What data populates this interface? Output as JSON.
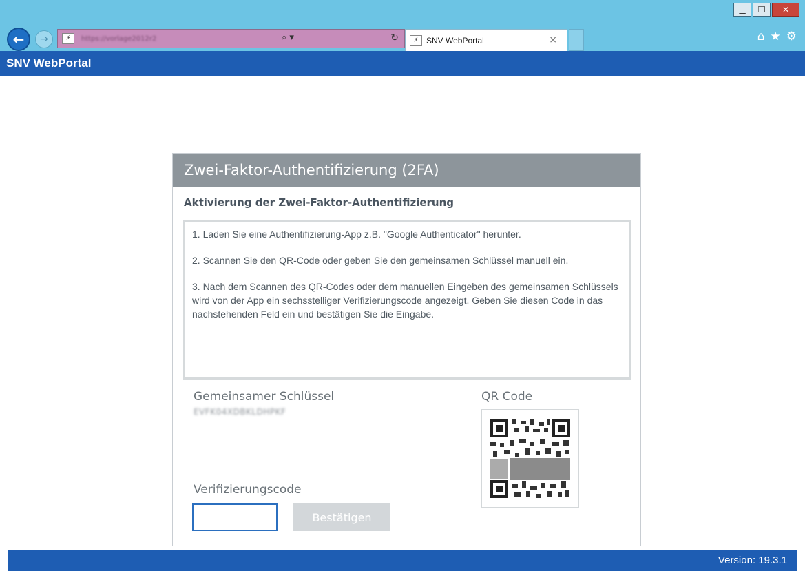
{
  "browser": {
    "window_controls": {
      "minimize": "▁",
      "restore": "❐",
      "close": "✕"
    },
    "address_text": "https://vorlage2012r2",
    "address_search_icon": "⌕ ▾",
    "address_refresh_icon": "↻",
    "tab_title": "SNV WebPortal",
    "tab_close": "×",
    "toolbar_icons": [
      "home-icon",
      "star-icon",
      "gear-icon"
    ]
  },
  "app": {
    "title": "SNV WebPortal"
  },
  "card": {
    "title": "Zwei-Faktor-Authentifizierung (2FA)",
    "subtitle": "Aktivierung der Zwei-Faktor-Authentifizierung",
    "steps": [
      "1. Laden Sie eine Authentifizierung-App z.B. \"Google Authenticator\" herunter.",
      "2. Scannen Sie den QR-Code oder geben Sie den gemeinsamen Schlüssel manuell ein.",
      "3. Nach dem Scannen des QR-Codes oder dem manuellen Eingeben des gemeinsamen Schlüssels wird von der App ein sechsstelliger Verifizierungscode angezeigt. Geben Sie diesen Code in das nachstehenden Feld ein und bestätigen Sie die Eingabe."
    ],
    "shared_key_label": "Gemeinsamer Schlüssel",
    "shared_key_value": "EVFK04XDBKLDHPKF",
    "qr_label": "QR Code",
    "verification_label": "Verifizierungscode",
    "verification_value": "",
    "confirm_label": "Bestätigen"
  },
  "footer": {
    "version": "Version: 19.3.1"
  },
  "colors": {
    "chrome": "#6cc4e4",
    "app_bar": "#1e5db3",
    "card_header": "#8d959b",
    "disabled_button": "#d3d7da"
  }
}
